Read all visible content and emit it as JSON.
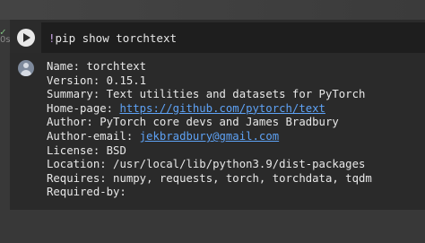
{
  "gutter": {
    "status_glyph": "✓",
    "status_color": "#7fbf7f",
    "execution_label": "0s"
  },
  "cell": {
    "run_button_icon": "play-icon",
    "code": {
      "bang": "!",
      "command": "pip show torchtext"
    },
    "output_avatar_icon": "user-avatar-icon",
    "output": {
      "name": {
        "key": "Name: ",
        "value": "torchtext"
      },
      "version": {
        "key": "Version: ",
        "value": "0.15.1"
      },
      "summary": {
        "key": "Summary: ",
        "value": "Text utilities and datasets for PyTorch"
      },
      "home_page": {
        "key": "Home-page: ",
        "value": "https://github.com/pytorch/text"
      },
      "author": {
        "key": "Author: ",
        "value": "PyTorch core devs and James Bradbury"
      },
      "author_email": {
        "key": "Author-email: ",
        "value": "jekbradbury@gmail.com"
      },
      "license": {
        "key": "License: ",
        "value": "BSD"
      },
      "location": {
        "key": "Location: ",
        "value": "/usr/local/lib/python3.9/dist-packages"
      },
      "requires": {
        "key": "Requires: ",
        "value": "numpy, requests, torch, torchdata, tqdm"
      },
      "required_by": {
        "key": "Required-by: ",
        "value": ""
      }
    }
  },
  "colors": {
    "link": "#5ea2f5",
    "magic_bang": "#c9a4e6",
    "text": "#e8e8e8"
  }
}
